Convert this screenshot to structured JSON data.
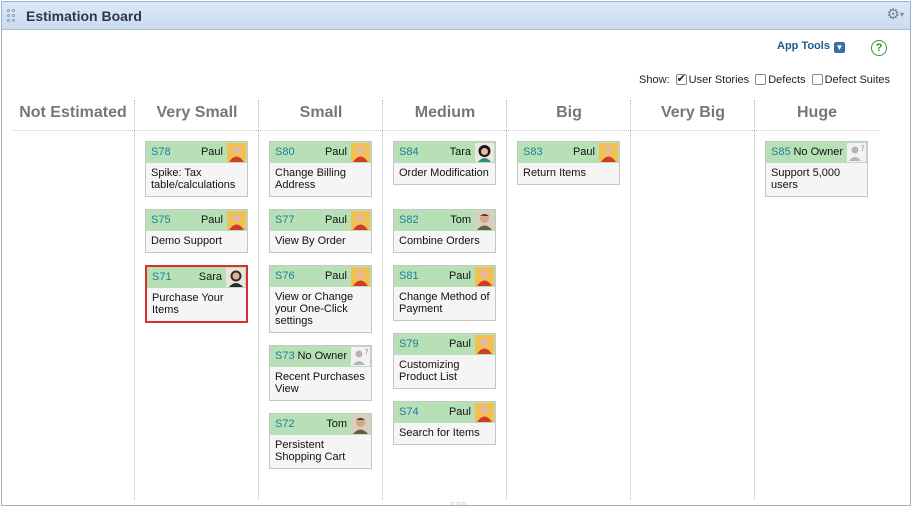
{
  "titlebar": {
    "title": "Estimation Board"
  },
  "toolbar": {
    "app_tools_label": "App Tools",
    "help_label": "?"
  },
  "show": {
    "label": "Show:",
    "options": [
      {
        "label": "User Stories",
        "checked": true
      },
      {
        "label": "Defects",
        "checked": false
      },
      {
        "label": "Defect Suites",
        "checked": false
      }
    ]
  },
  "columns": [
    {
      "name": "Not Estimated",
      "cards": []
    },
    {
      "name": "Very Small",
      "cards": [
        {
          "id": "S78",
          "owner": "Paul",
          "avatar": "paul",
          "title": "Spike: Tax table/calculations"
        },
        {
          "id": "S75",
          "owner": "Paul",
          "avatar": "paul",
          "title": "Demo Support"
        },
        {
          "id": "S71",
          "owner": "Sara",
          "avatar": "sara",
          "title": "Purchase Your Items",
          "selected": true
        }
      ]
    },
    {
      "name": "Small",
      "cards": [
        {
          "id": "S80",
          "owner": "Paul",
          "avatar": "paul",
          "title": "Change Billing Address"
        },
        {
          "id": "S77",
          "owner": "Paul",
          "avatar": "paul",
          "title": "View By Order"
        },
        {
          "id": "S76",
          "owner": "Paul",
          "avatar": "paul",
          "title": "View or Change your One-Click settings"
        },
        {
          "id": "S73",
          "owner": "No Owner",
          "avatar": "none",
          "title": "Recent Purchases View"
        },
        {
          "id": "S72",
          "owner": "Tom",
          "avatar": "tom",
          "title": "Persistent Shopping Cart"
        }
      ]
    },
    {
      "name": "Medium",
      "cards": [
        {
          "id": "S84",
          "owner": "Tara",
          "avatar": "tara",
          "title": "Order Modification"
        },
        {
          "id": "S82",
          "owner": "Tom",
          "avatar": "tom",
          "title": "Combine Orders"
        },
        {
          "id": "S81",
          "owner": "Paul",
          "avatar": "paul",
          "title": "Change Method of Payment"
        },
        {
          "id": "S79",
          "owner": "Paul",
          "avatar": "paul",
          "title": "Customizing Product List"
        },
        {
          "id": "S74",
          "owner": "Paul",
          "avatar": "paul",
          "title": "Search for Items"
        }
      ]
    },
    {
      "name": "Big",
      "cards": [
        {
          "id": "S83",
          "owner": "Paul",
          "avatar": "paul",
          "title": "Return Items"
        }
      ]
    },
    {
      "name": "Very Big",
      "cards": []
    },
    {
      "name": "Huge",
      "cards": [
        {
          "id": "S85",
          "owner": "No Owner",
          "avatar": "none",
          "title": "Support 5,000 users"
        }
      ]
    }
  ],
  "colors": {
    "card_header": "#b7e0b7",
    "card_id": "#1a7f9a",
    "selected_border": "#d9302c"
  }
}
